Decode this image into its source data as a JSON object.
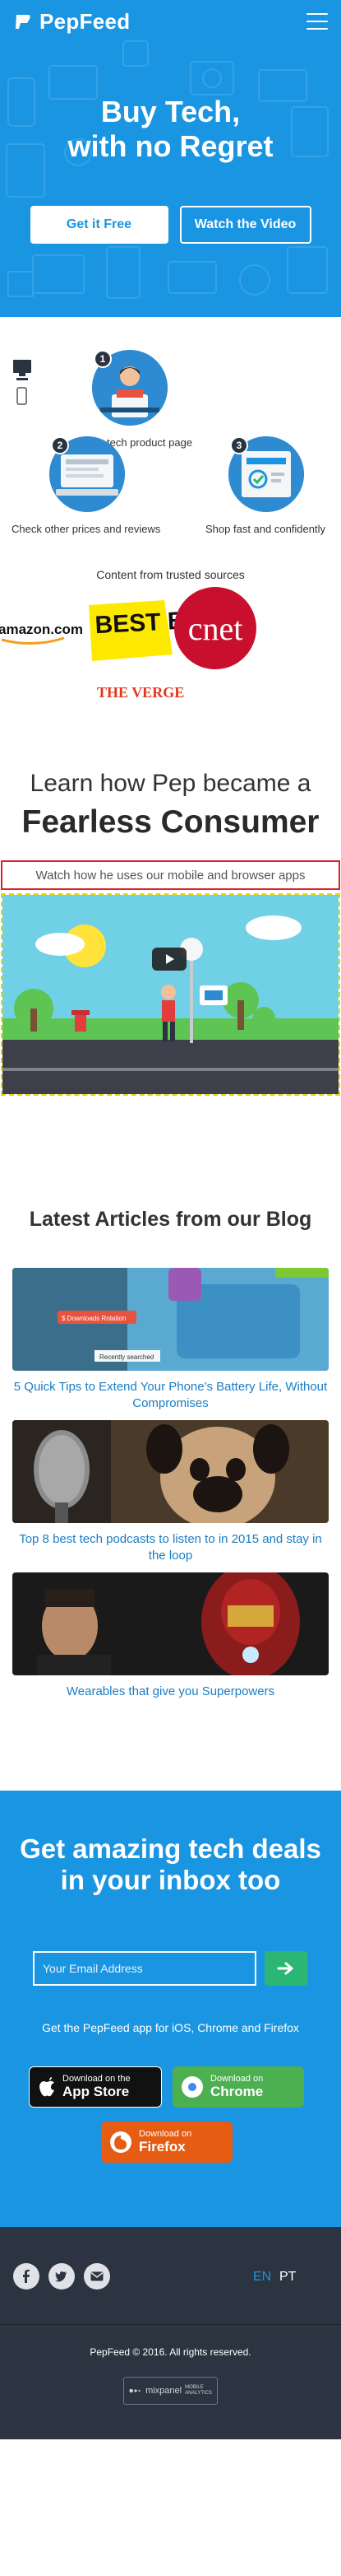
{
  "header": {
    "brand_name": "PepFeed",
    "menu_icon": "hamburger-menu-icon"
  },
  "hero": {
    "title_line1": "Buy Tech,",
    "title_line2": "with no Regret",
    "cta_primary": "Get it Free",
    "cta_secondary": "Watch the Video"
  },
  "how_it_works": {
    "steps": [
      {
        "number": "1",
        "label": "tech product page"
      },
      {
        "number": "2",
        "label": "Check other prices and reviews"
      },
      {
        "number": "3",
        "label": "Shop fast and confidently"
      }
    ],
    "trusted_title": "Content from trusted sources",
    "sources": [
      "amazon.com",
      "BEST BUY",
      "cnet",
      "THE VERGE"
    ]
  },
  "fearless": {
    "line1": "Learn how Pep became a",
    "line2": "Fearless Consumer",
    "watch_text": "Watch how he uses our mobile and browser apps"
  },
  "blog": {
    "title": "Latest Articles from our Blog",
    "articles": [
      {
        "title": "5 Quick Tips to Extend Your Phone's Battery Life, Without Compromises",
        "overlay_badge": "$ Downloads Rotation",
        "overlay_recent": "Recently searched"
      },
      {
        "title": "Top 8 best tech podcasts to listen to in 2015 and stay in the loop"
      },
      {
        "title": "Wearables that give you Superpowers"
      }
    ]
  },
  "newsletter": {
    "title": "Get amazing tech deals in your inbox too",
    "email_placeholder": "Your Email Address",
    "apps_text": "Get the PepFeed app for iOS, Chrome and Firefox",
    "appstore_small": "Download on the",
    "appstore_big": "App Store",
    "chrome_small": "Download on",
    "chrome_big": "Chrome",
    "firefox_small": "Download on",
    "firefox_big": "Firefox"
  },
  "footer": {
    "lang_en": "EN",
    "lang_pt": "PT",
    "copyright": "PepFeed © 2016. All rights reserved.",
    "mixpanel_name": "mixpanel",
    "mixpanel_sub1": "MOBILE",
    "mixpanel_sub2": "ANALYTICS"
  },
  "colors": {
    "brand_blue": "#1a95e2",
    "link_blue": "#1a7dc4",
    "submit_green": "#2bb673",
    "chrome_green": "#4caf50",
    "firefox_orange": "#e65c12",
    "footer_dark": "#2b3440"
  }
}
